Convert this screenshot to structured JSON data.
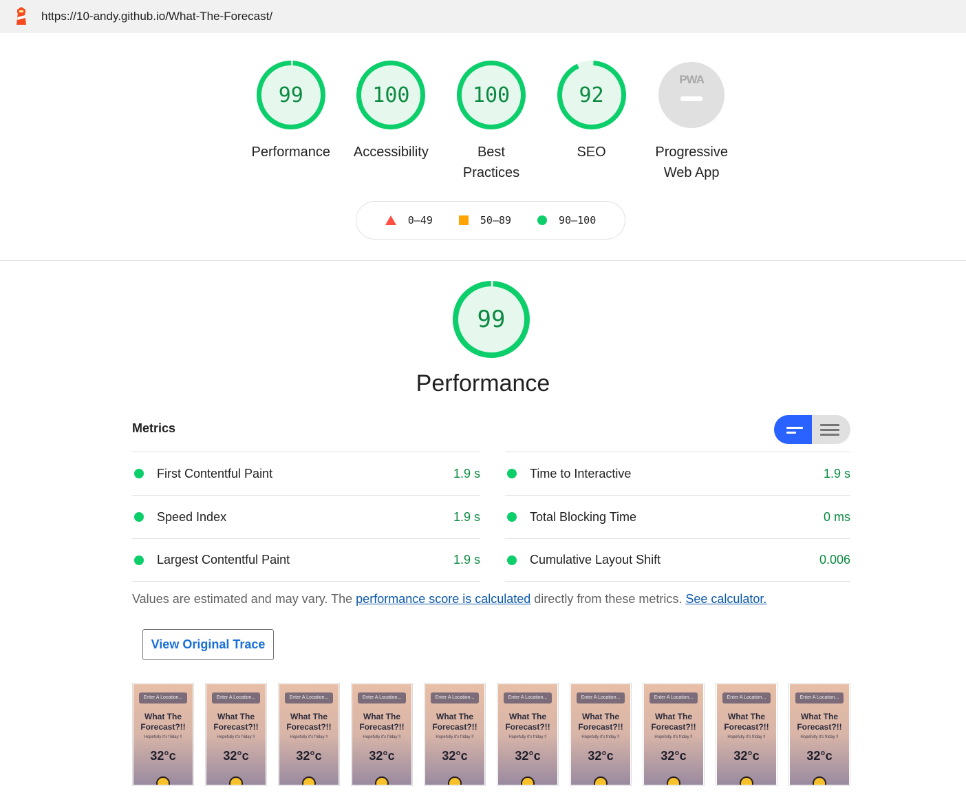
{
  "browser": {
    "url": "https://10-andy.github.io/What-The-Forecast/"
  },
  "colors": {
    "pass": "#0cce6b",
    "pass_text": "#0c8a41",
    "average": "#ffa400",
    "fail": "#ff4e42",
    "toggle_active": "#2962ff",
    "link": "#0b57a8"
  },
  "gauges": [
    {
      "score": "99",
      "label": "Performance",
      "fraction": 0.99
    },
    {
      "score": "100",
      "label": "Accessibility",
      "fraction": 1.0
    },
    {
      "score": "100",
      "label_line1": "Best",
      "label_line2": "Practices",
      "fraction": 1.0
    },
    {
      "score": "92",
      "label": "SEO",
      "fraction": 0.92
    }
  ],
  "pwa": {
    "badge_text": "PWA",
    "label_line1": "Progressive",
    "label_line2": "Web App"
  },
  "legend": {
    "fail": "0–49",
    "average": "50–89",
    "pass": "90–100"
  },
  "performance": {
    "score": "99",
    "fraction": 0.99,
    "title": "Performance"
  },
  "metrics": {
    "heading": "Metrics",
    "items": [
      {
        "label": "First Contentful Paint",
        "value": "1.9 s"
      },
      {
        "label": "Time to Interactive",
        "value": "1.9 s"
      },
      {
        "label": "Speed Index",
        "value": "1.9 s"
      },
      {
        "label": "Total Blocking Time",
        "value": "0 ms"
      },
      {
        "label": "Largest Contentful Paint",
        "value": "1.9 s"
      },
      {
        "label": "Cumulative Layout Shift",
        "value": "0.006"
      }
    ]
  },
  "note": {
    "prefix": "Values are estimated and may vary. The ",
    "link1": "performance score is calculated",
    "middle": " directly from these metrics. ",
    "link2": "See calculator."
  },
  "trace_button": "View Original Trace",
  "filmstrip": {
    "frames": 10,
    "input_text": "Enter A Location...",
    "title_line1": "What The",
    "title_line2": "Forecast?!!",
    "subtitle": "Hopefully it's friday !!",
    "temperature": "32°c"
  }
}
